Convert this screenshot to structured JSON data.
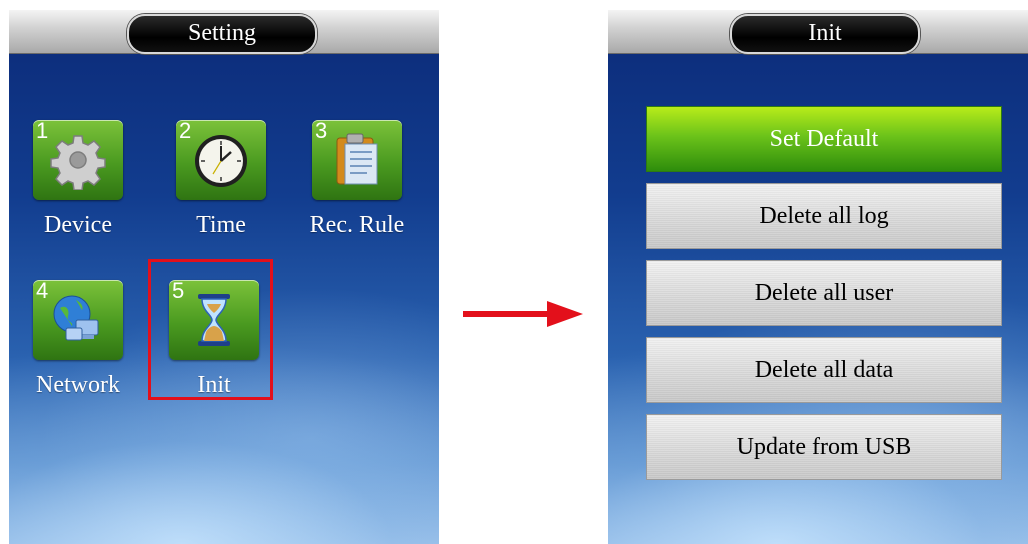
{
  "setting_screen": {
    "title": "Setting",
    "apps": [
      {
        "number": "1",
        "label": "Device",
        "icon": "gear-icon"
      },
      {
        "number": "2",
        "label": "Time",
        "icon": "clock-icon"
      },
      {
        "number": "3",
        "label": "Rec. Rule",
        "icon": "clipboard-icon"
      },
      {
        "number": "4",
        "label": "Network",
        "icon": "globe-network-icon"
      },
      {
        "number": "5",
        "label": "Init",
        "icon": "hourglass-icon"
      }
    ],
    "selected_app": "Init"
  },
  "init_screen": {
    "title": "Init",
    "menu": [
      {
        "label": "Set Default",
        "active": true
      },
      {
        "label": "Delete all log",
        "active": false
      },
      {
        "label": "Delete all user",
        "active": false
      },
      {
        "label": "Delete all data",
        "active": false
      },
      {
        "label": "Update from USB",
        "active": false
      }
    ]
  },
  "colors": {
    "highlight": "#e3101b",
    "arrow": "#e3101b",
    "tile_green": "#4a9a20",
    "active_green": "#6cc31a"
  }
}
